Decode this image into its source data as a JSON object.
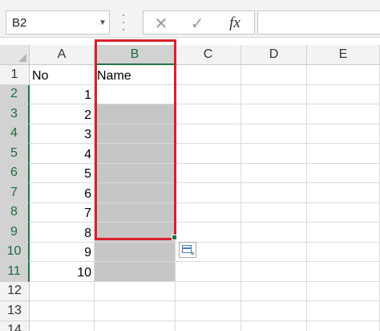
{
  "formula_bar": {
    "name_box": "B2",
    "cancel_icon": "✕",
    "enter_icon": "✓",
    "fx_label": "fx",
    "formula": ""
  },
  "columns": [
    "A",
    "B",
    "C",
    "D",
    "E"
  ],
  "rows": [
    "1",
    "2",
    "3",
    "4",
    "5",
    "6",
    "7",
    "8",
    "9",
    "10",
    "11",
    "12",
    "13",
    "14"
  ],
  "cells": {
    "A1": "No",
    "B1": "Name",
    "A2": "1",
    "A3": "2",
    "A4": "3",
    "A5": "4",
    "A6": "5",
    "A7": "6",
    "A8": "7",
    "A9": "8",
    "A10": "9",
    "A11": "10"
  },
  "selection": {
    "active_cell": "B2",
    "range": "B2:B11",
    "highlight_color": "#d9202b"
  },
  "colors": {
    "excel_green": "#217346",
    "selection_fill": "#c6c6c6"
  }
}
